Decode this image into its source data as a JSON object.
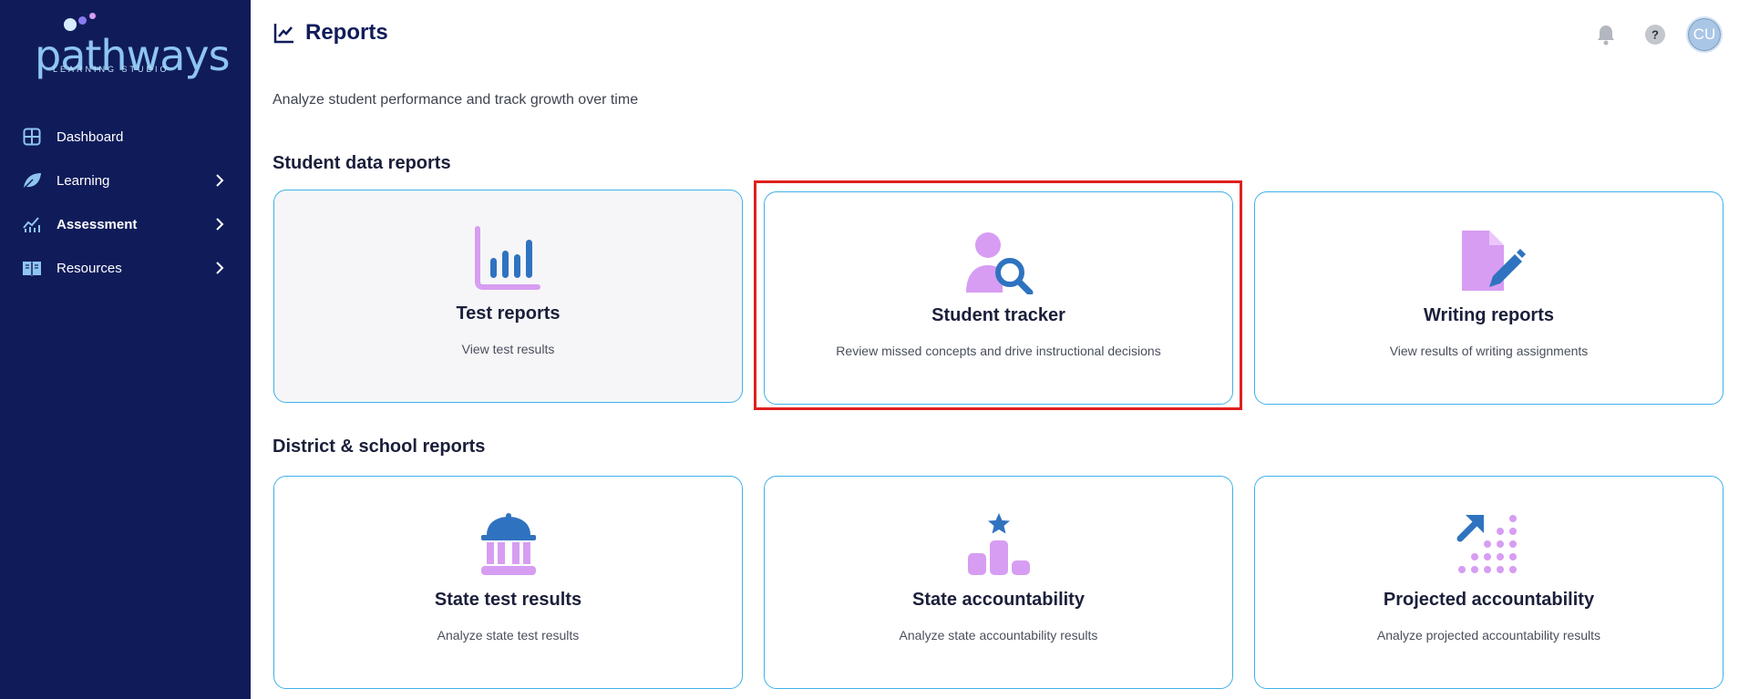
{
  "brand": {
    "name": "pathways",
    "tagline": "LEARNING STUDIO"
  },
  "sidebar": {
    "items": [
      {
        "label": "Dashboard",
        "icon": "dashboard-icon"
      },
      {
        "label": "Learning",
        "icon": "leaf-icon"
      },
      {
        "label": "Assessment",
        "icon": "chart-icon"
      },
      {
        "label": "Resources",
        "icon": "book-icon"
      }
    ]
  },
  "header": {
    "title": "Reports",
    "subtitle": "Analyze student performance and track growth over time",
    "avatar_initials": "CU"
  },
  "sections": {
    "student": {
      "title": "Student data reports",
      "cards": [
        {
          "title": "Test reports",
          "desc": "View test results"
        },
        {
          "title": "Student tracker",
          "desc": "Review missed concepts and drive instructional decisions"
        },
        {
          "title": "Writing reports",
          "desc": "View results of writing assignments"
        }
      ]
    },
    "district": {
      "title": "District & school reports",
      "cards": [
        {
          "title": "State test results",
          "desc": "Analyze state test results"
        },
        {
          "title": "State accountability",
          "desc": "Analyze state accountability results"
        },
        {
          "title": "Projected accountability",
          "desc": "Analyze projected accountability results"
        }
      ]
    }
  },
  "colors": {
    "sidebar_bg": "#101c5a",
    "card_border": "#3fb1ea",
    "icon_purple": "#d79df2",
    "icon_blue": "#2f73c0",
    "highlight": "#e01f1f"
  }
}
